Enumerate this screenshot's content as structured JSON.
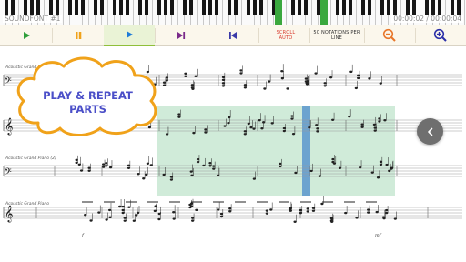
{
  "header": {
    "soundfont_label": "SOUNDFONT #1",
    "time_label": "00:00:02 / 00:00:04"
  },
  "toolbar": {
    "scroll_label": "SCROLL AUTO",
    "notations_label": "50 NOTATIONS PER LINE",
    "buttons": [
      {
        "name": "play",
        "icon": "play-icon",
        "color": "#2e9e3a"
      },
      {
        "name": "pause",
        "icon": "pause-icon",
        "color": "#f0a21a"
      },
      {
        "name": "play-from",
        "icon": "play-icon",
        "color": "#1e7bd8",
        "active": true
      },
      {
        "name": "skip-next",
        "icon": "skip-next-icon",
        "color": "#7a2a8a"
      },
      {
        "name": "skip-previous",
        "icon": "skip-previous-icon",
        "color": "#3a3aa8"
      },
      {
        "name": "zoom-out",
        "icon": "zoom-out-icon",
        "color": "#e8762a"
      },
      {
        "name": "zoom-in",
        "icon": "zoom-in-icon",
        "color": "#2b2fa8"
      }
    ]
  },
  "score": {
    "instrument_1": "Acoustic Grand P...",
    "instrument_2": "Acoustic Grand Piano (2)",
    "instrument_3": "Acoustic Grand Piano",
    "dynamic_1": "f",
    "dynamic_2": "mf"
  },
  "callout": {
    "line1": "PLAY & REPEAT",
    "line2": "PARTS"
  },
  "colors": {
    "accent_green": "#3aa83e",
    "loop_region": "#96d2aa",
    "playhead": "#5a96cd",
    "callout_text": "#4b4fc8",
    "callout_border": "#f0a21a"
  }
}
